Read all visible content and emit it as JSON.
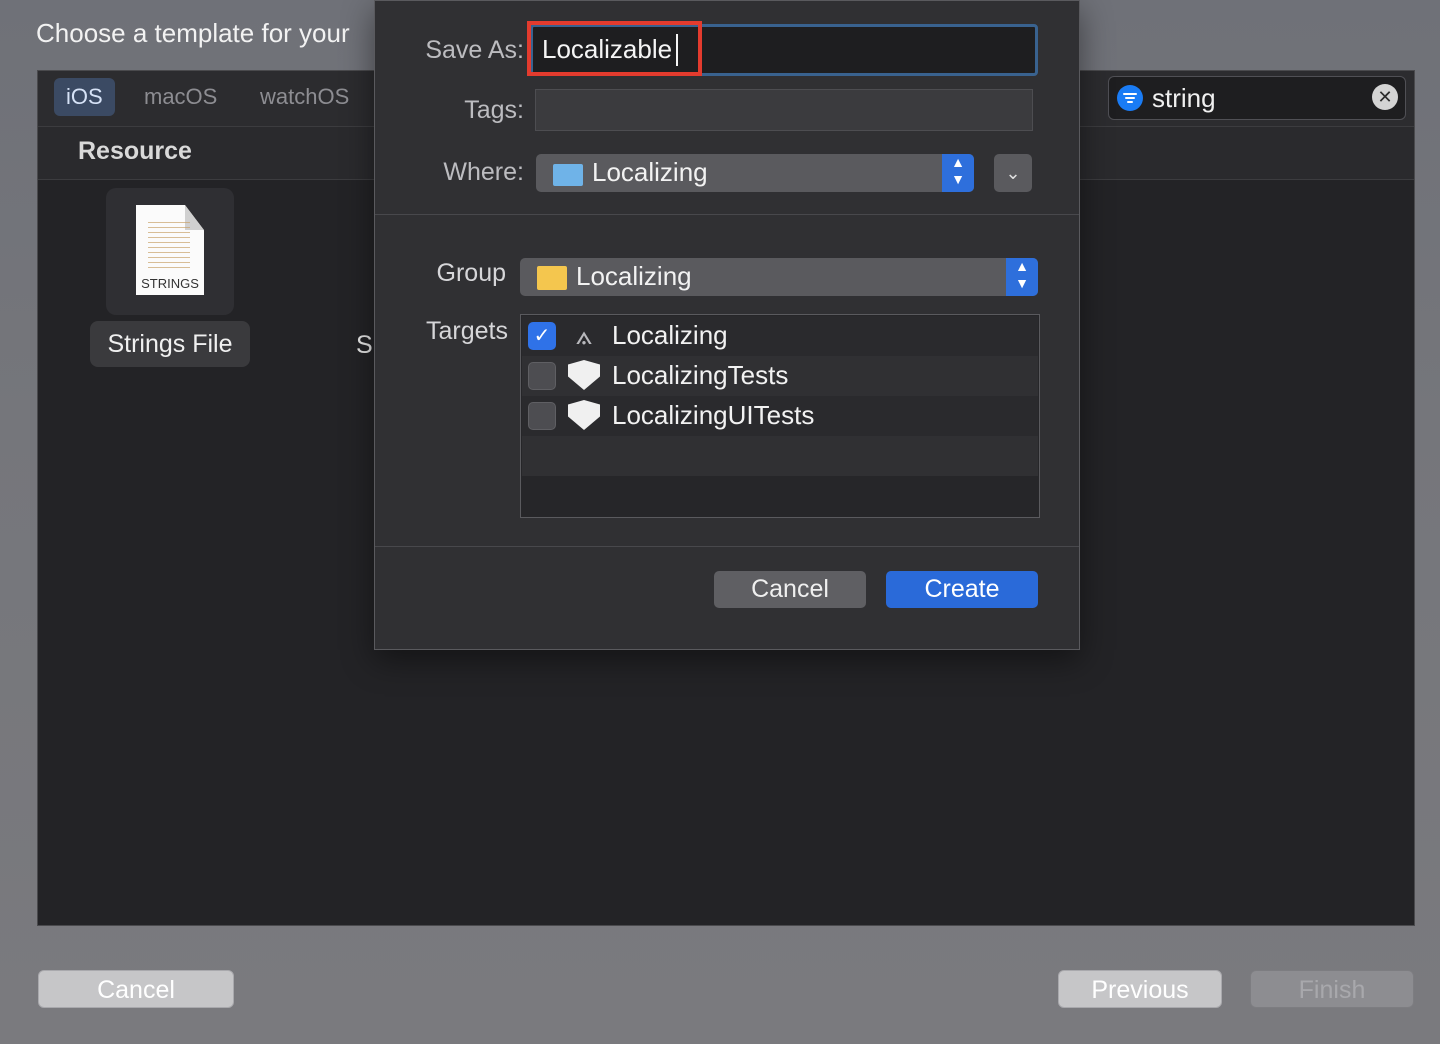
{
  "background": {
    "title": "Choose a template for your",
    "platform_tabs": [
      "iOS",
      "macOS",
      "watchOS"
    ],
    "section_title": "Resource",
    "search": {
      "value": "string",
      "icon": "filter-icon"
    },
    "template": {
      "name": "Strings File",
      "icon_label": "STRINGS"
    },
    "partial_text": "S",
    "buttons": {
      "cancel": "Cancel",
      "previous": "Previous",
      "finish": "Finish"
    }
  },
  "sheet": {
    "save_as": {
      "label": "Save As:",
      "value": "Localizable"
    },
    "tags": {
      "label": "Tags:",
      "value": ""
    },
    "where": {
      "label": "Where:",
      "value": "Localizing"
    },
    "group": {
      "label": "Group",
      "value": "Localizing"
    },
    "targets": {
      "label": "Targets",
      "items": [
        {
          "name": "Localizing",
          "checked": true,
          "icon": "app-target-icon"
        },
        {
          "name": "LocalizingTests",
          "checked": false,
          "icon": "test-target-icon"
        },
        {
          "name": "LocalizingUITests",
          "checked": false,
          "icon": "test-target-icon"
        }
      ]
    },
    "buttons": {
      "cancel": "Cancel",
      "create": "Create"
    }
  },
  "colors": {
    "accent": "#2a6ad9",
    "highlight": "#e33b2e",
    "group_folder": "#f4c64e",
    "where_folder": "#6fb3e8"
  }
}
